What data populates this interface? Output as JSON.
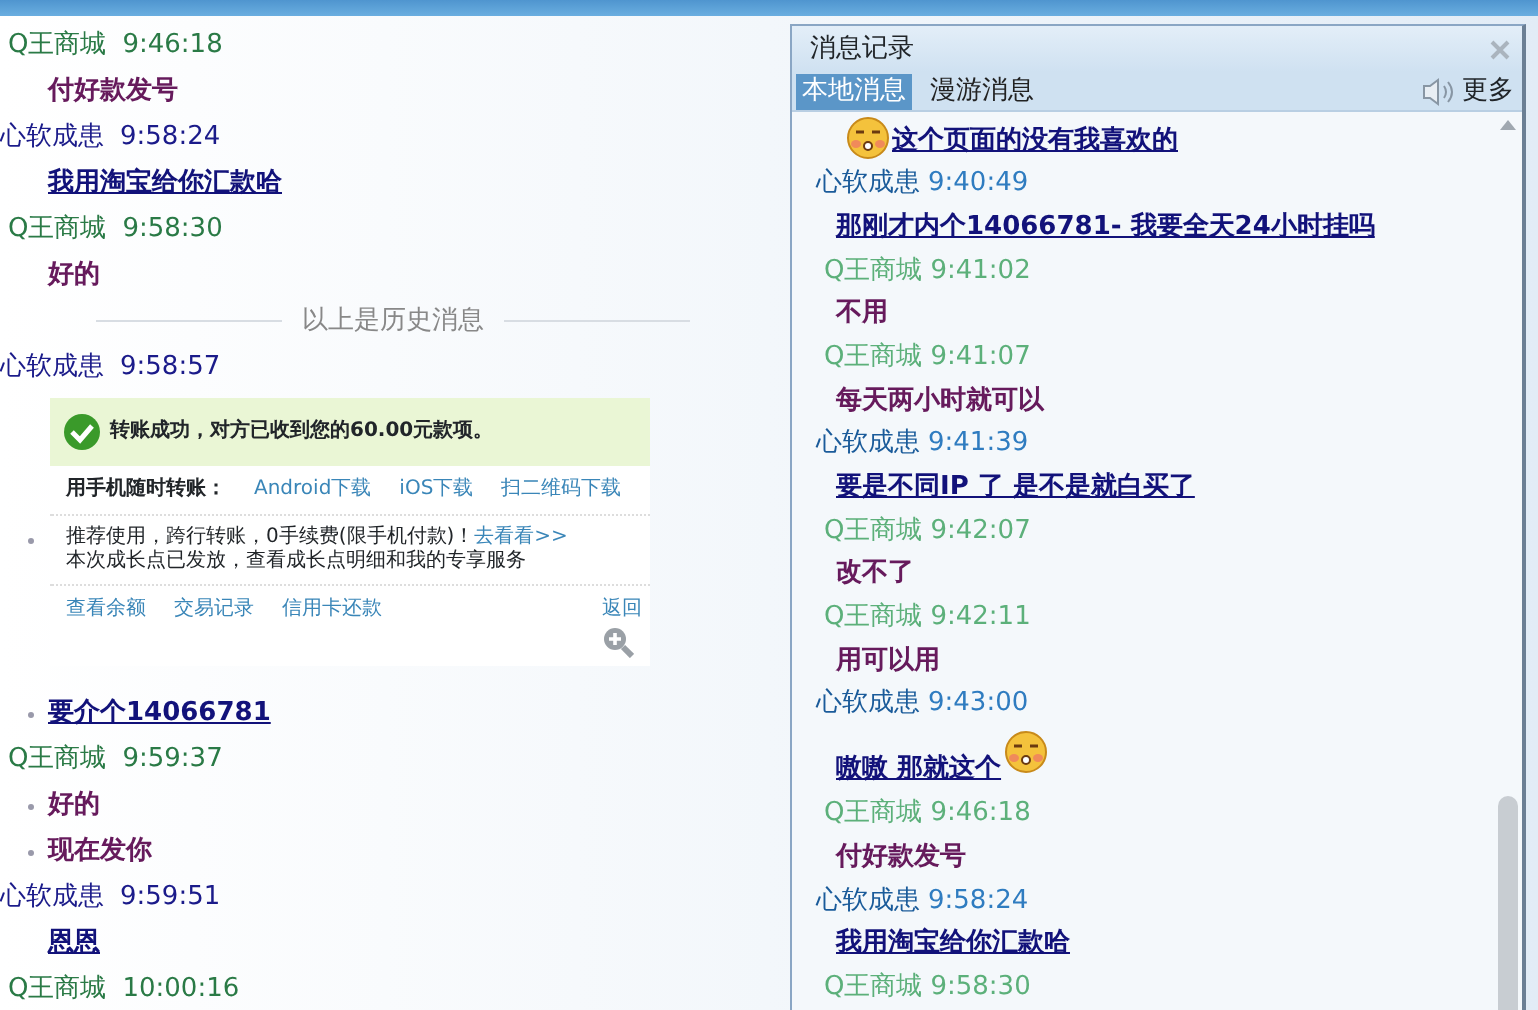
{
  "chat_log": {
    "entries": [
      {
        "kind": "header",
        "self": false,
        "sender": "Q王商城",
        "time": "9:46:18"
      },
      {
        "kind": "text",
        "self": false,
        "text": "付好款发号",
        "bullet": false
      },
      {
        "kind": "header",
        "self": true,
        "sender": "心软成患",
        "time": "9:58:24"
      },
      {
        "kind": "text",
        "self": true,
        "text": "我用淘宝给你汇款哈",
        "bullet": false
      },
      {
        "kind": "header",
        "self": false,
        "sender": "Q王商城",
        "time": "9:58:30"
      },
      {
        "kind": "text",
        "self": false,
        "text": "好的",
        "bullet": false
      },
      {
        "kind": "divider",
        "text": "以上是历史消息"
      },
      {
        "kind": "header",
        "self": true,
        "sender": "心软成患",
        "time": "9:58:57"
      },
      {
        "kind": "image",
        "bullet": true,
        "screenshot": {
          "notice": "转账成功，对方已收到您的60.00元款项。",
          "download_label": "用手机随时转账：",
          "download_links": [
            "Android下载",
            "iOS下载",
            "扫二维码下载"
          ],
          "promo": "推荐使用，跨行转账，0手续费(限手机付款)！",
          "promo_link": "去看看>>",
          "growth": "本次成长点已发放，查看成长点明细和我的专享服务",
          "footer_links": [
            "查看余额",
            "交易记录",
            "信用卡还款"
          ],
          "footer_right": "返回"
        }
      },
      {
        "kind": "text",
        "self": true,
        "text": "要介个14066781",
        "bullet": true
      },
      {
        "kind": "header",
        "self": false,
        "sender": "Q王商城",
        "time": "9:59:37"
      },
      {
        "kind": "text",
        "self": false,
        "text": "好的",
        "bullet": true
      },
      {
        "kind": "text",
        "self": false,
        "text": "现在发你",
        "bullet": true
      },
      {
        "kind": "header",
        "self": true,
        "sender": "心软成患",
        "time": "9:59:51"
      },
      {
        "kind": "text",
        "self": true,
        "text": "恩恩",
        "bullet": false
      },
      {
        "kind": "header",
        "self": false,
        "sender": "Q王商城",
        "time": "10:00:16"
      }
    ]
  },
  "history_panel": {
    "title": "消息记录",
    "tabs": [
      {
        "label": "本地消息",
        "selected": true
      },
      {
        "label": "漫游消息",
        "selected": false
      }
    ],
    "more": "更多",
    "entries": [
      {
        "kind": "text",
        "self": true,
        "text": "这个页面的没有我喜欢的",
        "leading_emoticon": true
      },
      {
        "kind": "header",
        "self": true,
        "sender": "心软成患",
        "time": "9:40:49"
      },
      {
        "kind": "text",
        "self": true,
        "text": "那刚才内个14066781- 我要全天24小时挂吗"
      },
      {
        "kind": "header",
        "self": false,
        "sender": "Q王商城",
        "time": "9:41:02"
      },
      {
        "kind": "text",
        "self": false,
        "text": "不用"
      },
      {
        "kind": "header",
        "self": false,
        "sender": "Q王商城",
        "time": "9:41:07"
      },
      {
        "kind": "text",
        "self": false,
        "text": "每天两小时就可以"
      },
      {
        "kind": "header",
        "self": true,
        "sender": "心软成患",
        "time": "9:41:39"
      },
      {
        "kind": "text",
        "self": true,
        "text": "要是不同IP 了 是不是就白买了"
      },
      {
        "kind": "header",
        "self": false,
        "sender": "Q王商城",
        "time": "9:42:07"
      },
      {
        "kind": "text",
        "self": false,
        "text": "改不了"
      },
      {
        "kind": "header",
        "self": false,
        "sender": "Q王商城",
        "time": "9:42:11"
      },
      {
        "kind": "text",
        "self": false,
        "text": "用可以用"
      },
      {
        "kind": "header",
        "self": true,
        "sender": "心软成患",
        "time": "9:43:00"
      },
      {
        "kind": "text",
        "self": true,
        "text": "嗷嗷 那就这个",
        "trailing_emoticon": true
      },
      {
        "kind": "header",
        "self": false,
        "sender": "Q王商城",
        "time": "9:46:18"
      },
      {
        "kind": "text",
        "self": false,
        "text": "付好款发号"
      },
      {
        "kind": "header",
        "self": true,
        "sender": "心软成患",
        "time": "9:58:24"
      },
      {
        "kind": "text",
        "self": true,
        "text": "我用淘宝给你汇款哈"
      },
      {
        "kind": "header",
        "self": false,
        "sender": "Q王商城",
        "time": "9:58:30"
      }
    ]
  }
}
